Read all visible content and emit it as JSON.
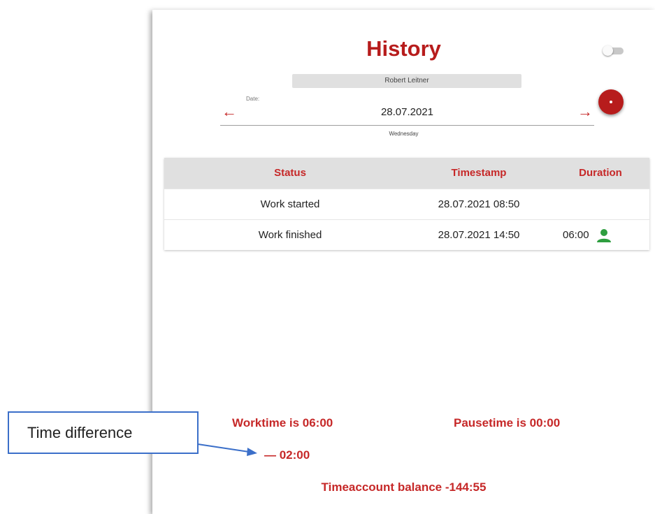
{
  "header": {
    "title": "History"
  },
  "user": {
    "name": "Robert Leitner"
  },
  "date": {
    "label": "Date:",
    "value": "28.07.2021",
    "weekday": "Wednesday"
  },
  "table": {
    "columns": [
      "Status",
      "Timestamp",
      "Duration"
    ],
    "rows": [
      {
        "status": "Work started",
        "timestamp": "28.07.2021 08:50",
        "duration": ""
      },
      {
        "status": "Work finished",
        "timestamp": "28.07.2021 14:50",
        "duration": "06:00"
      }
    ]
  },
  "summary": {
    "worktime": "Worktime is 06:00",
    "pausetime": "Pausetime is 00:00",
    "difference": "— 02:00",
    "balance": "Timeaccount balance -144:55"
  },
  "annotation": {
    "callout_text": "Time difference"
  },
  "icons": {
    "prev": "arrow-left-icon",
    "next": "arrow-right-icon",
    "person": "person-icon",
    "add": "add-icon"
  },
  "colors": {
    "accent": "#b71c1c",
    "person_icon": "#2e9e3f",
    "callout_border": "#3b6fc9"
  }
}
